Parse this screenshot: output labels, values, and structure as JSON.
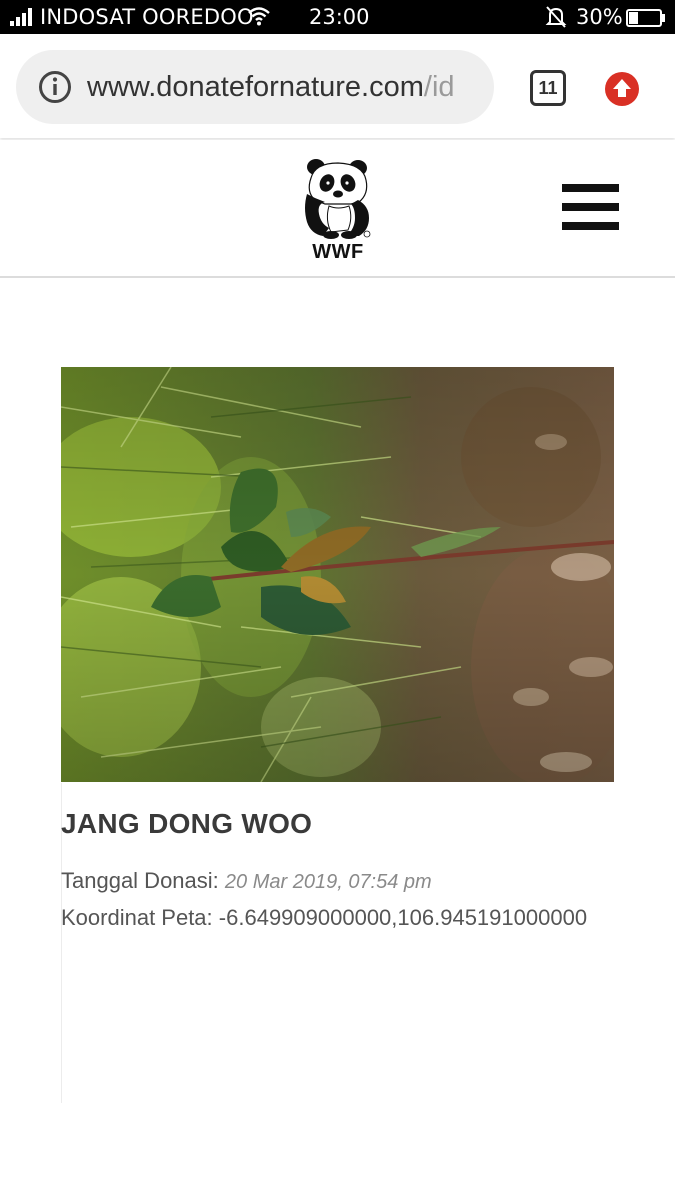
{
  "status_bar": {
    "carrier": "INDOSAT OOREDOO",
    "time": "23:00",
    "battery_percent": "30%",
    "battery_level": 0.3
  },
  "browser": {
    "url_host": "www.donatefornature.com",
    "url_path": "/id",
    "tab_count": "11"
  },
  "site": {
    "logo_text": "WWF"
  },
  "donation": {
    "name": "JANG DONG WOO",
    "date_label": "Tanggal Donasi:",
    "date_value": "20 Mar 2019, 07:54 pm",
    "coord_label": "Koordinat Peta:",
    "coord_value": "-6.649909000000,106.945191000000"
  },
  "colors": {
    "update_badge": "#d93025",
    "status_bar_bg": "#000000"
  },
  "icons": {
    "signal": "signal-icon",
    "wifi": "wifi-icon",
    "mute": "bell-muted-icon",
    "battery": "battery-icon",
    "info": "info-icon",
    "tabs": "tabs-icon",
    "update": "update-arrow-icon",
    "menu": "hamburger-menu-icon"
  }
}
